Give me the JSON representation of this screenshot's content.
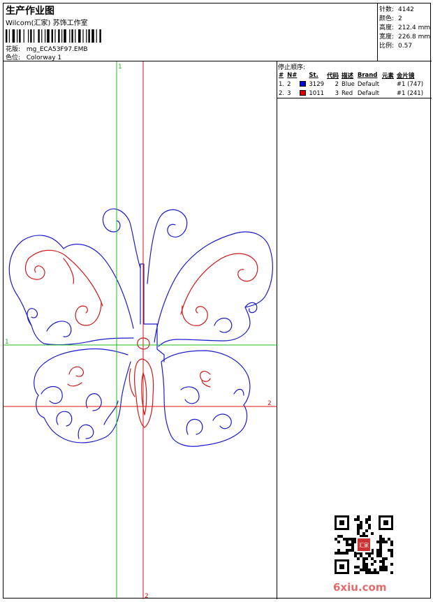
{
  "header": {
    "title": "生产作业图",
    "company": "Wilcom(汇家) 苏饰工作室",
    "design_label": "花版:",
    "design_value": "mg_ECA53F97.EMB",
    "colorway_label": "色位:",
    "colorway_value": "Colorway 1"
  },
  "specs": [
    {
      "label": "针数:",
      "value": "4142"
    },
    {
      "label": "颜色:",
      "value": "2"
    },
    {
      "label": "高度:",
      "value": "212.4 mm"
    },
    {
      "label": "宽度:",
      "value": "226.8 mm"
    },
    {
      "label": "比例:",
      "value": "0.57"
    }
  ],
  "axes": {
    "v1_label": "1",
    "v2_label": "2",
    "h1_label": "1",
    "h2_label": "2",
    "v1_color": "#22bb22",
    "v2_color": "#dd1111",
    "h1_color": "#22bb22",
    "h2_color": "#dd1111"
  },
  "stop_sequence": {
    "title": "停止顺序:",
    "columns": [
      "#",
      "N#",
      "St.",
      "代码",
      "描述",
      "Brand",
      "元素",
      "金片镜"
    ],
    "rows": [
      {
        "num": "1.",
        "n": "2",
        "color": "#0000dd",
        "stitches": "3129",
        "code": "2",
        "desc": "Blue",
        "brand": "Default",
        "element": "",
        "sequin": "#1 (747)"
      },
      {
        "num": "2.",
        "n": "3",
        "color": "#dd0000",
        "stitches": "1011",
        "code": "3",
        "desc": "Red",
        "brand": "Default",
        "element": "",
        "sequin": "#1 (241)"
      }
    ]
  },
  "thread_colors": {
    "blue": "#1a1acc",
    "red": "#cc1a1a"
  },
  "watermark": {
    "text": "6xiu.com",
    "color": "#e46b6b",
    "seal_text": "汇家"
  }
}
